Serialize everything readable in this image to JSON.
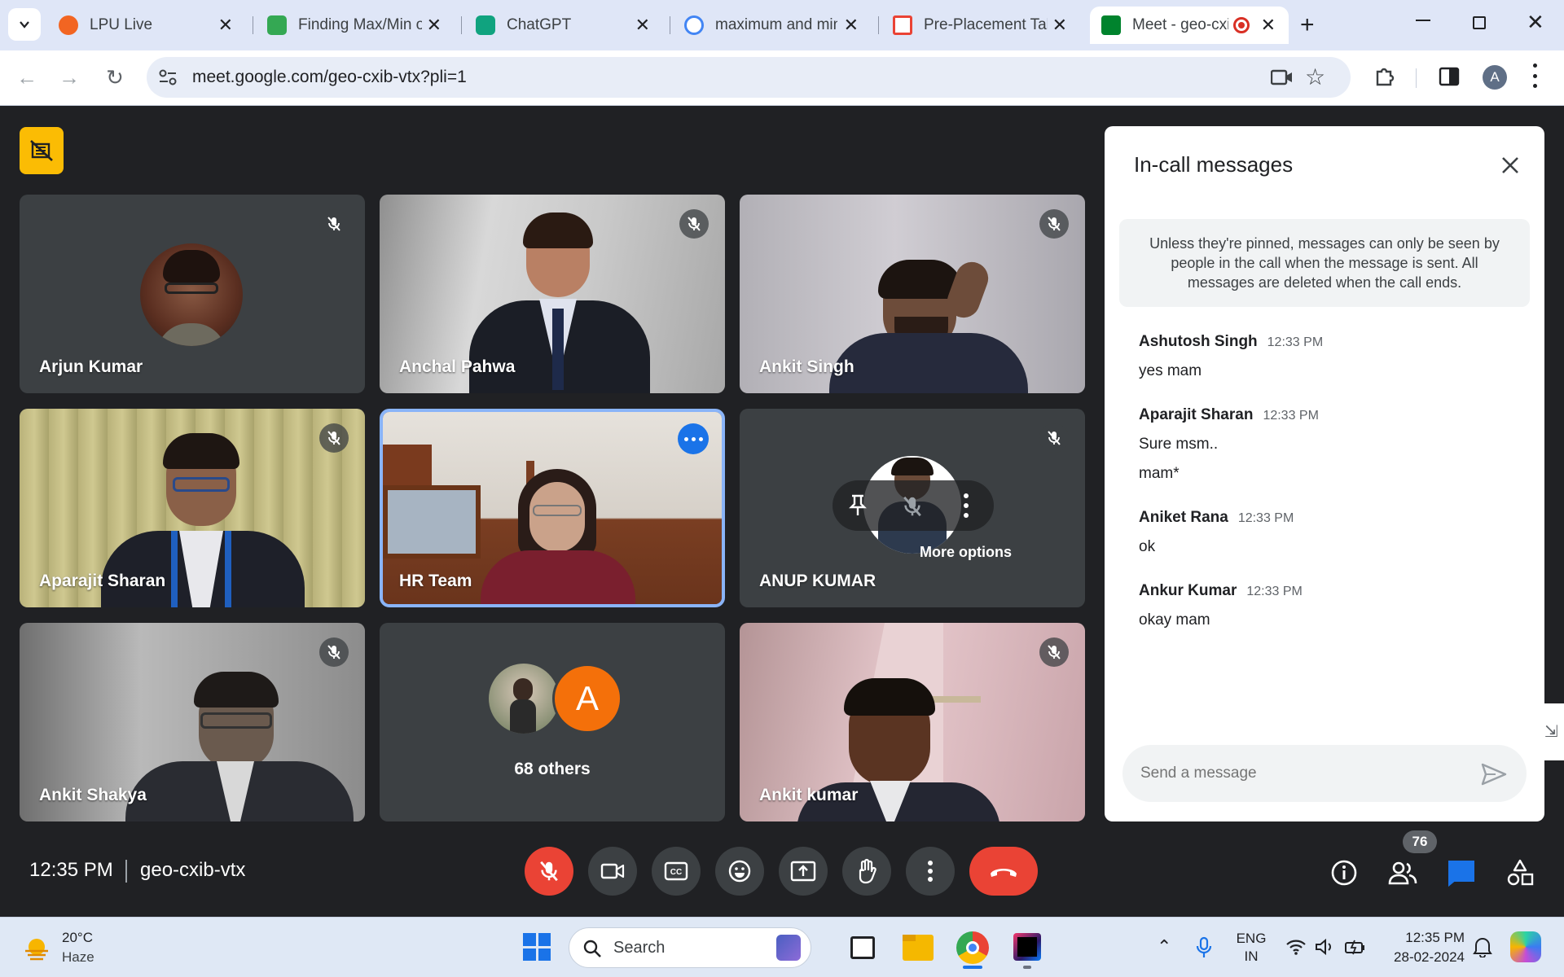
{
  "tabs": [
    {
      "label": "LPU Live",
      "fav_color": "#f26522"
    },
    {
      "label": "Finding Max/Min of",
      "fav_color": "#34a853"
    },
    {
      "label": "ChatGPT",
      "fav_color": "#10a37f"
    },
    {
      "label": "maximum and min",
      "fav_color": "#4285f4"
    },
    {
      "label": "Pre-Placement Talk",
      "fav_color": "#ea4335"
    },
    {
      "label": "Meet - geo-cxi",
      "fav_color": "#00832d"
    }
  ],
  "address": {
    "url": "meet.google.com/geo-cxib-vtx?pli=1",
    "profile_initial": "A"
  },
  "participants": [
    {
      "name": "Arjun Kumar"
    },
    {
      "name": "Anchal Pahwa"
    },
    {
      "name": "Ankit Singh"
    },
    {
      "name": "Aparajit Sharan"
    },
    {
      "name": "HR Team"
    },
    {
      "name": "ANUP KUMAR"
    },
    {
      "name": "Ankit Shakya"
    },
    {
      "name": "Ankit kumar"
    }
  ],
  "others": {
    "label": "68 others",
    "avatar_letter": "A"
  },
  "tooltip": "More options",
  "chat": {
    "title": "In-call messages",
    "notice": "Unless they're pinned, messages can only be seen by people in the call when the message is sent. All messages are deleted when the call ends.",
    "messages": [
      {
        "sender": "Ashutosh Singh",
        "time": "12:33 PM",
        "texts": [
          "yes mam"
        ]
      },
      {
        "sender": "Aparajit Sharan",
        "time": "12:33 PM",
        "texts": [
          "Sure msm..",
          "mam*"
        ]
      },
      {
        "sender": "Aniket Rana",
        "time": "12:33 PM",
        "texts": [
          "ok"
        ]
      },
      {
        "sender": "Ankur Kumar",
        "time": "12:33 PM",
        "texts": [
          "okay mam"
        ]
      }
    ],
    "input_placeholder": "Send a message"
  },
  "meeting": {
    "time": "12:35 PM",
    "code": "geo-cxib-vtx",
    "people_count": "76"
  },
  "taskbar": {
    "weather_temp": "20°C",
    "weather_desc": "Haze",
    "search_label": "Search",
    "lang_top": "ENG",
    "lang_bottom": "IN",
    "clock_time": "12:35 PM",
    "clock_date": "28-02-2024"
  },
  "colors": {
    "accent": "#1a73e8",
    "end_call": "#ea4335",
    "mic_off": "#ea4335",
    "meet_bg": "#202124"
  }
}
